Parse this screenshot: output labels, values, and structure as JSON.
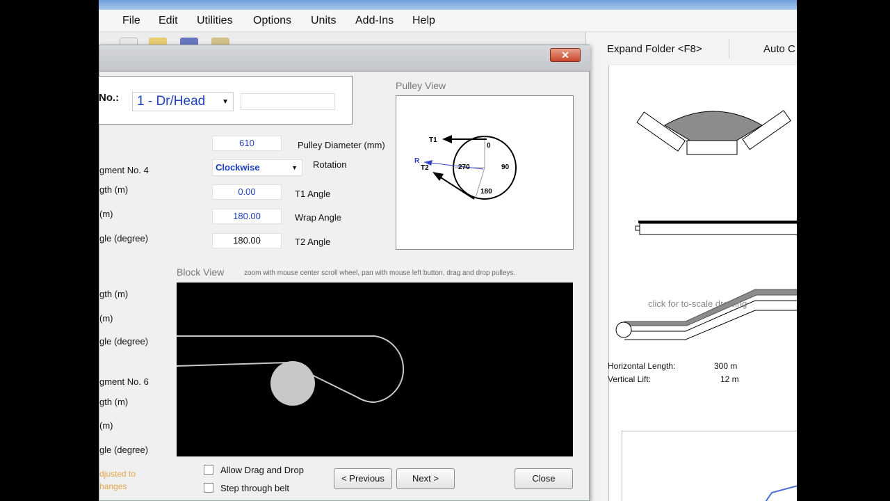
{
  "menu": {
    "file": "File",
    "edit": "Edit",
    "utilities": "Utilities",
    "options": "Options",
    "units": "Units",
    "addins": "Add-Ins",
    "help": "Help"
  },
  "right_panel": {
    "expand_folder": "Expand Folder <F8>",
    "auto_label": "Auto C",
    "to_scale": "click for to-scale drawing",
    "horizontal_length_label": "Horizontal Length:",
    "horizontal_length_value": "300 m",
    "vertical_lift_label": "Vertical Lift:",
    "vertical_lift_value": "12 m"
  },
  "dialog": {
    "close_glyph": "✕",
    "pulley_no_label": "No.:",
    "pulley_selected": "1 - Dr/Head",
    "pulley_diameter_value": "610",
    "pulley_diameter_label": "Pulley Diameter (mm)",
    "rotation_value": "Clockwise",
    "rotation_label": "Rotation",
    "t1_value": "0.00",
    "t1_label": "T1 Angle",
    "wrap_value": "180.00",
    "wrap_label": "Wrap Angle",
    "t2_value": "180.00",
    "t2_label": "T2 Angle",
    "left_labels": [
      "gment No. 4",
      "gth (m)",
      "(m)",
      "gle (degree)",
      "gth (m)",
      "(m)",
      "gle (degree)",
      "gment No. 6",
      "gth (m)",
      "(m)",
      "gle (degree)"
    ],
    "orange_note_1": "djusted to",
    "orange_note_2": "hanges",
    "pulley_view_title": "Pulley View",
    "pulley_view_labels": {
      "t1": "T1",
      "t2": "T2",
      "r": "R",
      "deg0": "0",
      "deg90": "90",
      "deg180": "180",
      "deg270": "270"
    },
    "block_view_title": "Block View",
    "block_hint": "zoom with mouse center scroll wheel, pan with mouse left button, drag and drop pulleys.",
    "allow_drag": "Allow Drag and Drop",
    "step_through": "Step through belt",
    "previous": "< Previous",
    "next": "Next >",
    "close": "Close"
  },
  "colors": {
    "accent_text": "#1f3fbf",
    "orange_note": "#e6a64a",
    "block_view_bg": "#000000"
  }
}
